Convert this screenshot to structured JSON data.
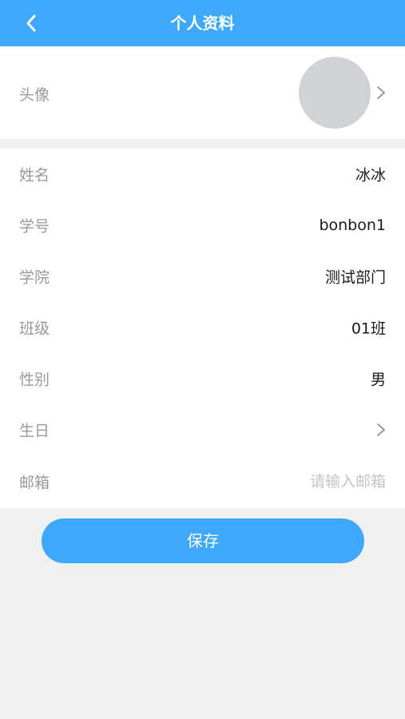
{
  "header": {
    "title": "个人资料",
    "back_icon": "chevron-left-icon"
  },
  "avatar_row": {
    "label": "头像",
    "chevron_icon": "chevron-right-icon"
  },
  "profile": {
    "rows": [
      {
        "label": "姓名",
        "value": "冰冰"
      },
      {
        "label": "学号",
        "value": "bonbon1"
      },
      {
        "label": "学院",
        "value": "测试部门"
      },
      {
        "label": "班级",
        "value": "01班"
      },
      {
        "label": "性别",
        "value": "男"
      },
      {
        "label": "生日",
        "value": ""
      },
      {
        "label": "邮箱",
        "value": ""
      }
    ],
    "email_placeholder": "请输入邮箱"
  },
  "save_label": "保存",
  "colors": {
    "accent": "#3ea8fa",
    "background": "#f0f0f1",
    "label": "#999999",
    "value": "#1a1a1a",
    "placeholder": "#c4c4c4",
    "avatar_placeholder": "#d1d2d6"
  }
}
